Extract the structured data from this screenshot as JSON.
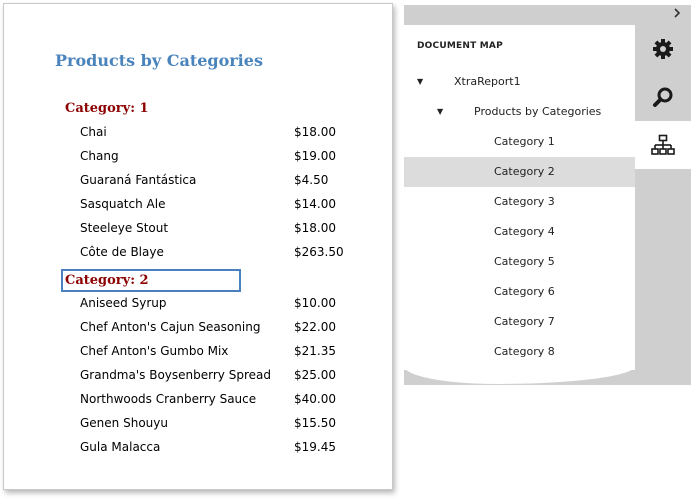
{
  "report": {
    "title": "Products by Categories",
    "groups": [
      {
        "header": "Category: 1",
        "products": [
          {
            "name": "Chai",
            "price": "$18.00"
          },
          {
            "name": "Chang",
            "price": "$19.00"
          },
          {
            "name": "Guaraná Fantástica",
            "price": "$4.50"
          },
          {
            "name": "Sasquatch Ale",
            "price": "$14.00"
          },
          {
            "name": "Steeleye Stout",
            "price": "$18.00"
          },
          {
            "name": "Côte de Blaye",
            "price": "$263.50"
          }
        ]
      },
      {
        "header": "Category: 2",
        "products": [
          {
            "name": "Aniseed Syrup",
            "price": "$10.00"
          },
          {
            "name": "Chef Anton's Cajun Seasoning",
            "price": "$22.00"
          },
          {
            "name": "Chef Anton's Gumbo Mix",
            "price": "$21.35"
          },
          {
            "name": "Grandma's Boysenberry Spread",
            "price": "$25.00"
          },
          {
            "name": "Northwoods Cranberry Sauce",
            "price": "$40.00"
          },
          {
            "name": "Genen Shouyu",
            "price": "$15.50"
          },
          {
            "name": "Gula Malacca",
            "price": "$19.45"
          }
        ]
      }
    ]
  },
  "panel": {
    "heading": "DOCUMENT MAP",
    "collapse_icon": "chevron-right-icon",
    "tree": {
      "root": "XtraReport1",
      "child": "Products by Categories",
      "categories": [
        "Category 1",
        "Category 2",
        "Category 3",
        "Category 4",
        "Category 5",
        "Category 6",
        "Category 7",
        "Category 8"
      ],
      "selected": "Category 2"
    },
    "tabs": [
      {
        "icon": "gear-icon",
        "active": false
      },
      {
        "icon": "search-icon",
        "active": false
      },
      {
        "icon": "document-map-icon",
        "active": true
      }
    ]
  },
  "colors": {
    "title": "#4a84bd",
    "category_header": "#8b0000",
    "selection_border": "#4a7fc0",
    "panel_bg": "#cfcfcf",
    "tree_selected": "#dcdcdc"
  }
}
